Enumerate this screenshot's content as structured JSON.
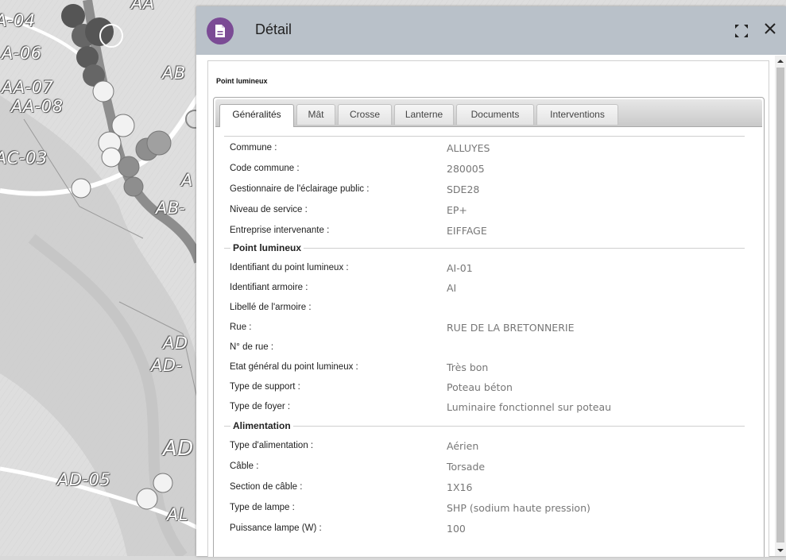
{
  "map": {
    "labels": [
      "AA",
      "A-04",
      "A-06",
      "AA-07",
      "AA-08",
      "AB",
      "AC-03",
      "A",
      "AB-",
      "AD",
      "AD-",
      "AD",
      "AD-05",
      "AL"
    ]
  },
  "panel": {
    "title": "Détail",
    "section_title": "Point lumineux",
    "colors": {
      "header": "#b9c1c9",
      "icon": "#7b4b95"
    }
  },
  "tabs": [
    {
      "label": "Généralités",
      "active": true
    },
    {
      "label": "Mât",
      "active": false
    },
    {
      "label": "Crosse",
      "active": false
    },
    {
      "label": "Lanterne",
      "active": false
    },
    {
      "label": "Documents",
      "active": false
    },
    {
      "label": "Interventions",
      "active": false
    }
  ],
  "general": [
    {
      "label": "Commune :",
      "value": "ALLUYES"
    },
    {
      "label": "Code commune :",
      "value": "280005"
    },
    {
      "label": "Gestionnaire de l'éclairage public :",
      "value": "SDE28"
    },
    {
      "label": "Niveau de service :",
      "value": "EP+"
    },
    {
      "label": "Entreprise intervenante :",
      "value": "EIFFAGE"
    }
  ],
  "point_lumineux": {
    "title": "Point lumineux",
    "fields": [
      {
        "label": "Identifiant du point lumineux :",
        "value": "AI-01"
      },
      {
        "label": "Identifiant armoire :",
        "value": "AI"
      },
      {
        "label": "Libellé de l'armoire :",
        "value": ""
      },
      {
        "label": "Rue :",
        "value": "RUE DE LA BRETONNERIE"
      },
      {
        "label": "N° de rue :",
        "value": ""
      },
      {
        "label": "Etat général du point lumineux :",
        "value": "Très bon"
      },
      {
        "label": "Type de support :",
        "value": "Poteau béton"
      },
      {
        "label": "Type de foyer :",
        "value": "Luminaire fonctionnel sur poteau"
      }
    ]
  },
  "alimentation": {
    "title": "Alimentation",
    "fields": [
      {
        "label": "Type d'alimentation :",
        "value": "Aérien"
      },
      {
        "label": "Câble :",
        "value": "Torsade"
      },
      {
        "label": "Section de câble :",
        "value": "1X16"
      },
      {
        "label": "Type de lampe :",
        "value": "SHP (sodium haute pression)"
      },
      {
        "label": "Puissance lampe (W) :",
        "value": "100"
      }
    ]
  }
}
